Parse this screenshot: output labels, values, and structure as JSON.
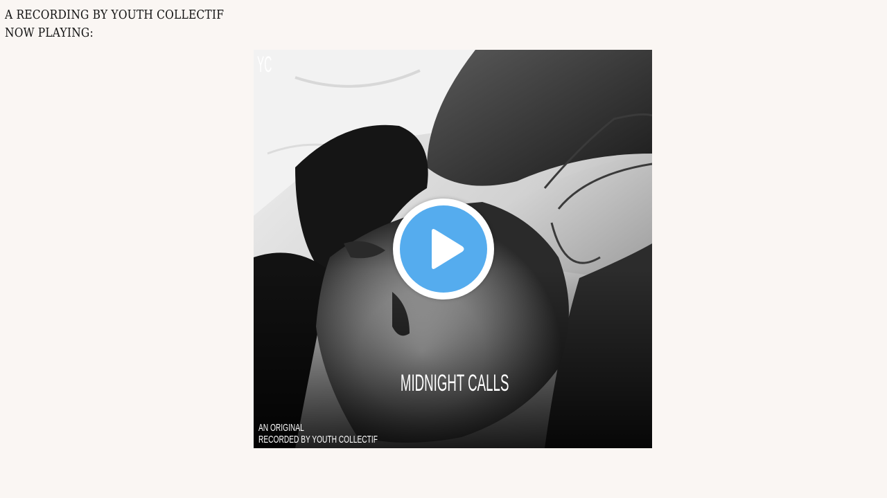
{
  "header": {
    "line1": "A RECORDING BY YOUTH COLLECTIF",
    "line2": "NOW PLAYING:"
  },
  "cover": {
    "logo": "YC",
    "title": "MIDNIGHT CALLS",
    "credit_line1": "AN ORIGINAL",
    "credit_line2": "RECORDED BY YOUTH COLLECTIF"
  },
  "player": {
    "play_icon": "play-icon",
    "accent_color": "#55acee"
  }
}
